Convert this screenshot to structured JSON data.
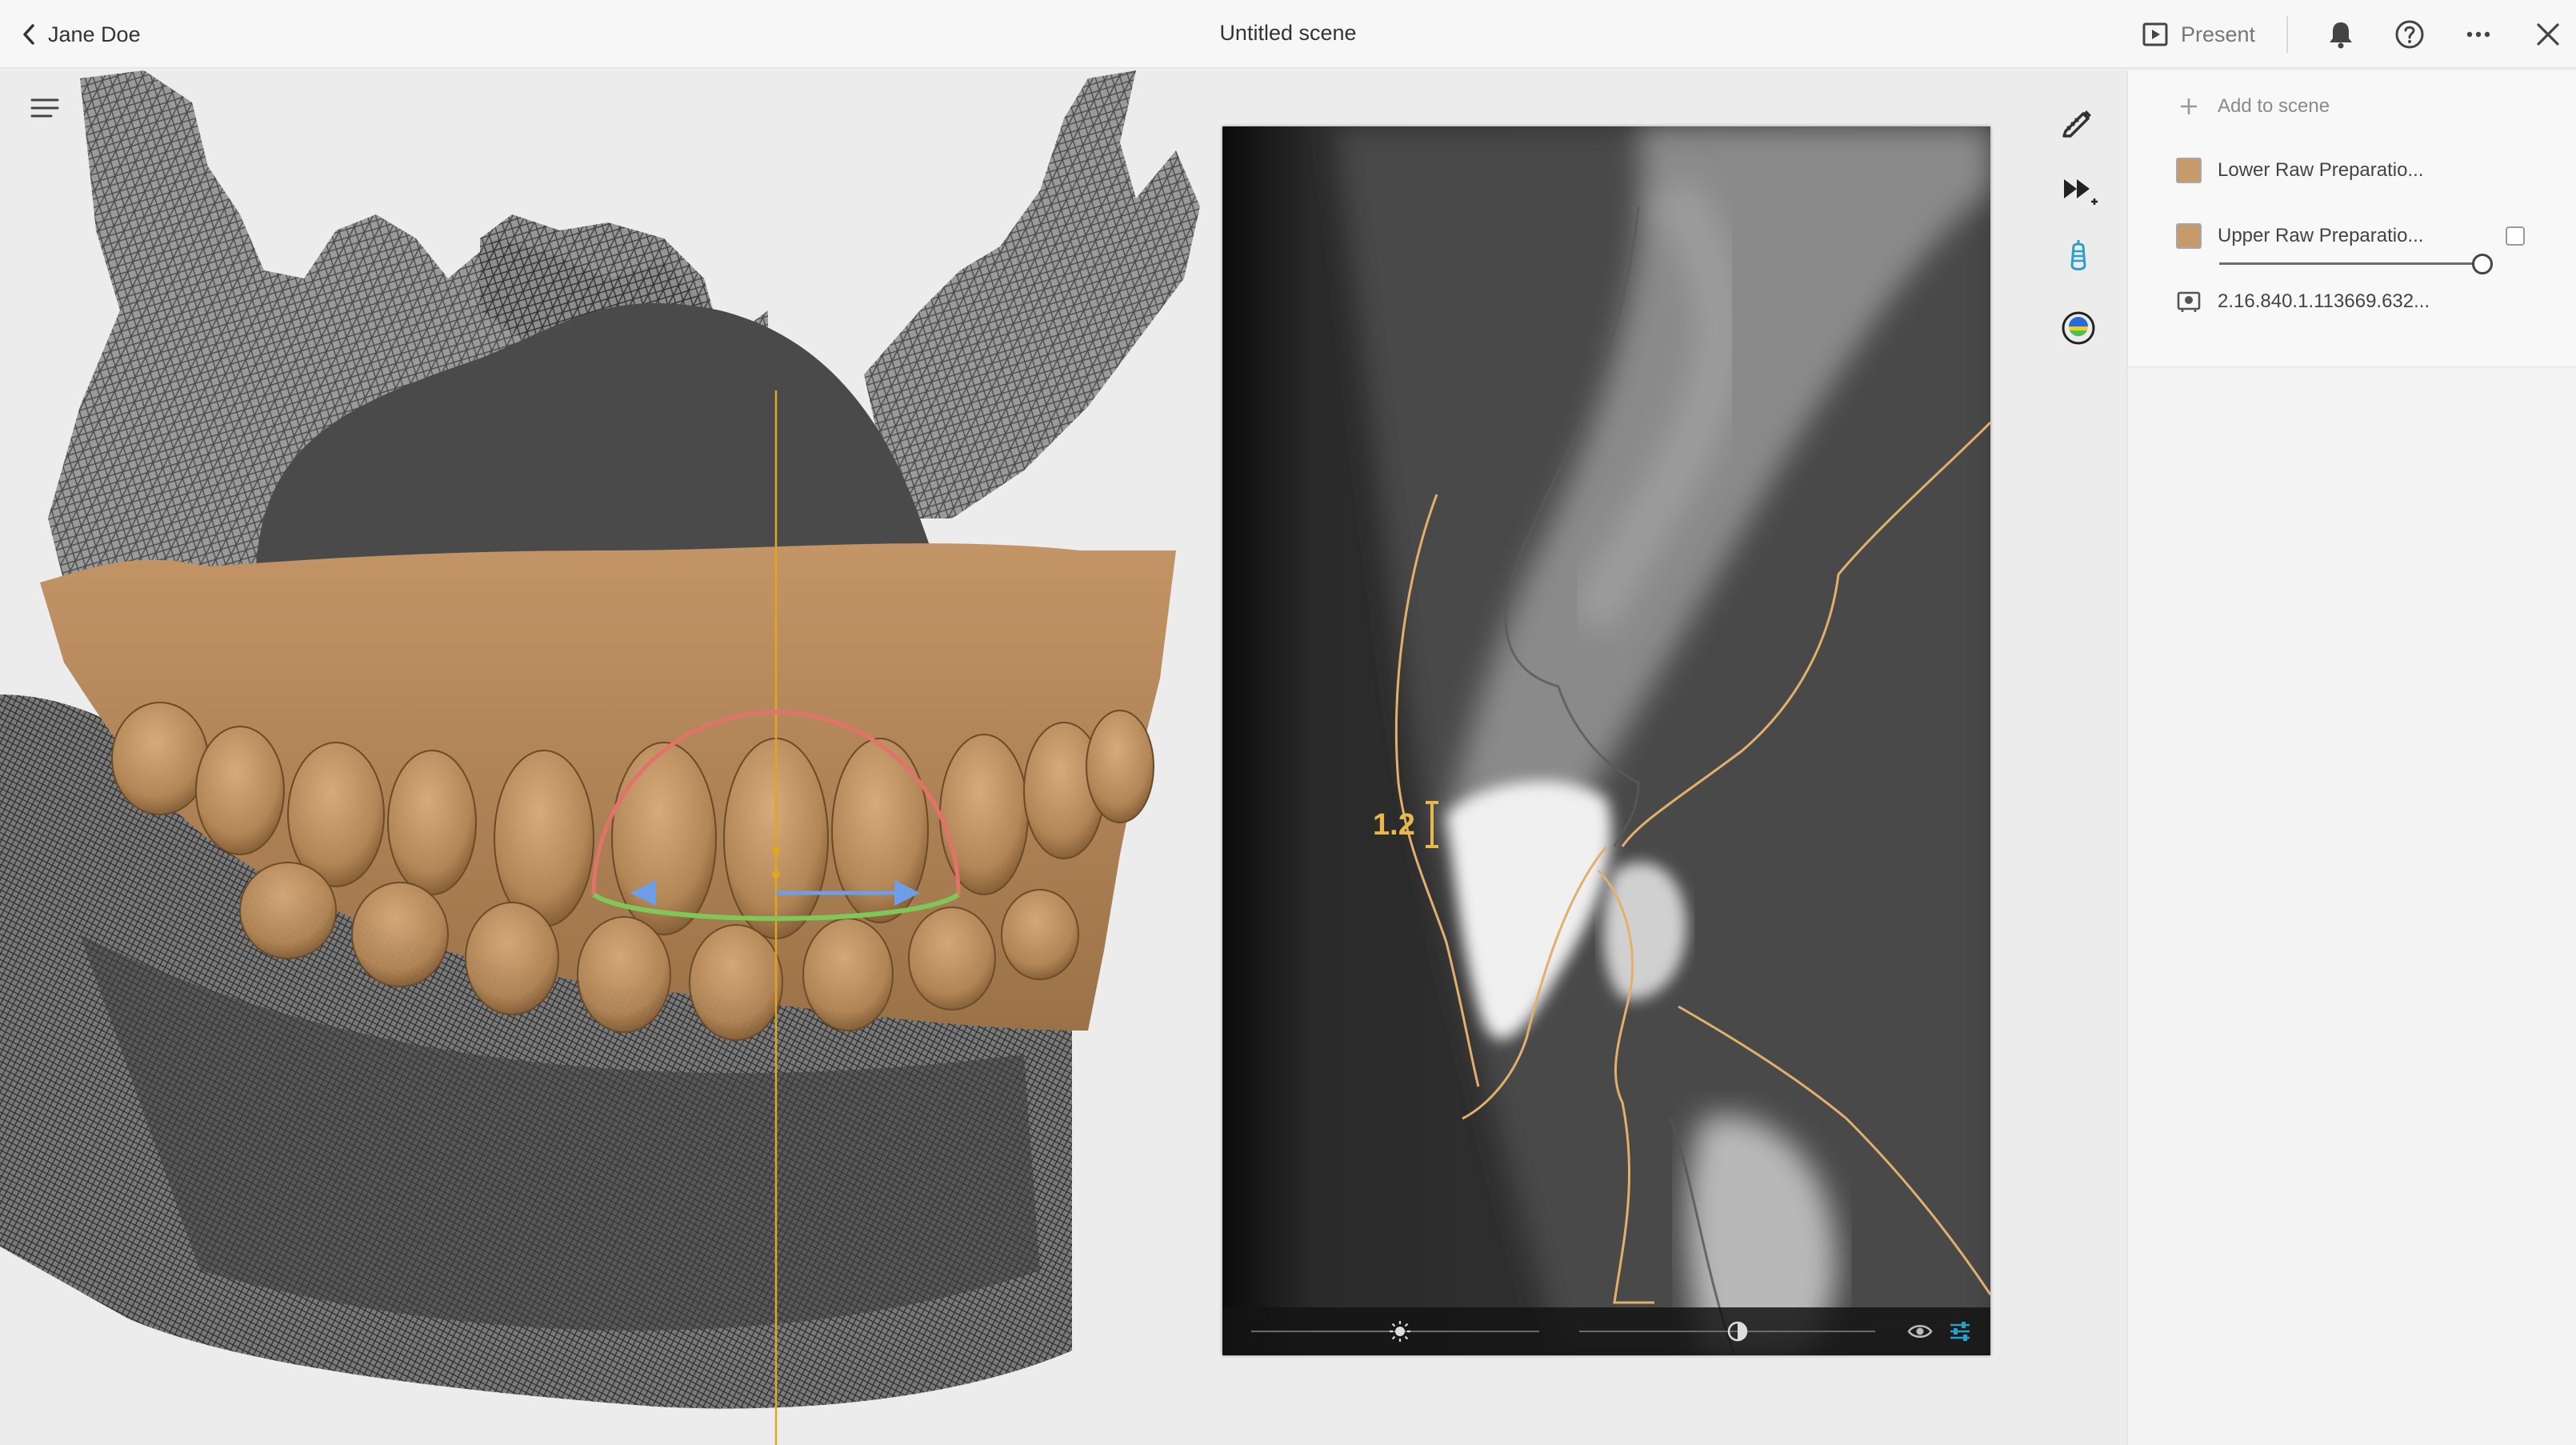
{
  "topbar": {
    "back_label": "Jane Doe",
    "scene_title": "Untitled scene",
    "present_label": "Present"
  },
  "ct_view": {
    "measurement": "1.2",
    "brightness": 0.5,
    "contrast": 0.5
  },
  "panel": {
    "add_label": "Add to scene",
    "items": [
      {
        "label": "Lower Raw Preparatio...",
        "icon": "swatch",
        "color": "#c79a6b"
      },
      {
        "label": "Upper Raw Preparatio...",
        "icon": "swatch",
        "color": "#c79a6b",
        "opacity": 1.0
      },
      {
        "label": "2.16.840.1.113669.632...",
        "icon": "dicom-volume-icon"
      }
    ]
  },
  "colors": {
    "model": "#b58a5c",
    "mesh": "#3a3a3a",
    "axis": "#e0a61e",
    "arc_red": "#e0736a",
    "arc_green": "#7ec85a",
    "arrow_blue": "#6e9ee8",
    "accent": "#2aa0c8"
  }
}
